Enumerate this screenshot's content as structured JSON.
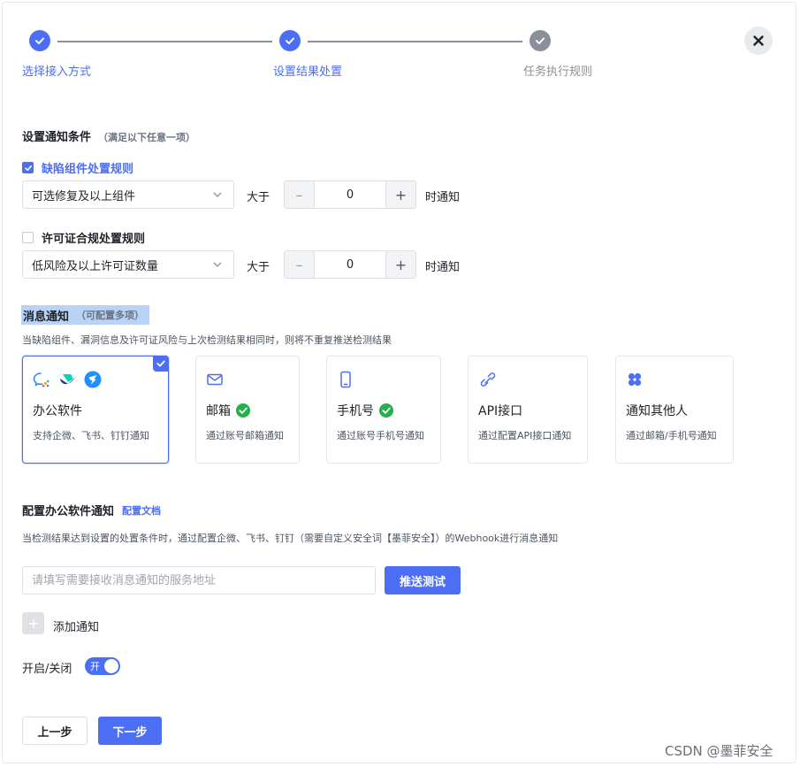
{
  "steps": [
    {
      "label": "选择接入方式",
      "state": "done"
    },
    {
      "label": "设置结果处置",
      "state": "done"
    },
    {
      "label": "任务执行规则",
      "state": "pending"
    }
  ],
  "conditions": {
    "title": "设置通知条件",
    "hint": "（满足以下任意一项）",
    "rules": [
      {
        "label": "缺陷组件处置规则",
        "checked": true,
        "select": "可选修复及以上组件",
        "gt": "大于",
        "value": "0",
        "suffix": "时通知"
      },
      {
        "label": "许可证合规处置规则",
        "checked": false,
        "select": "低风险及以上许可证数量",
        "gt": "大于",
        "value": "0",
        "suffix": "时通知"
      }
    ]
  },
  "notify": {
    "title": "消息通知",
    "hint": "（可配置多项）",
    "desc": "当缺陷组件、漏洞信息及许可证风险与上次检测结果相同时，则将不重复推送检测结果",
    "cards": [
      {
        "title": "办公软件",
        "desc": "支持企微、飞书、钉钉通知",
        "selected": true
      },
      {
        "title": "邮箱",
        "desc": "通过账号邮箱通知",
        "verified": true
      },
      {
        "title": "手机号",
        "desc": "通过账号手机号通知",
        "verified": true
      },
      {
        "title": "API接口",
        "desc": "通过配置API接口通知"
      },
      {
        "title": "通知其他人",
        "desc": "通过邮箱/手机号通知"
      }
    ]
  },
  "office": {
    "title": "配置办公软件通知",
    "doc_link": "配置文档",
    "desc": "当检测结果达到设置的处置条件时，通过配置企微、飞书、钉钉（需要自定义安全词【墨菲安全】）的Webhook进行消息通知",
    "input_placeholder": "请填写需要接收消息通知的服务地址",
    "push_test": "推送测试",
    "add_label": "添加通知",
    "toggle_label": "开启/关闭",
    "toggle_state": "开"
  },
  "footer": {
    "prev": "上一步",
    "next": "下一步"
  },
  "watermark": "CSDN @墨菲安全",
  "colors": {
    "accent": "#4c6ef5",
    "pending": "#8a8f99",
    "success": "#22b14c"
  }
}
